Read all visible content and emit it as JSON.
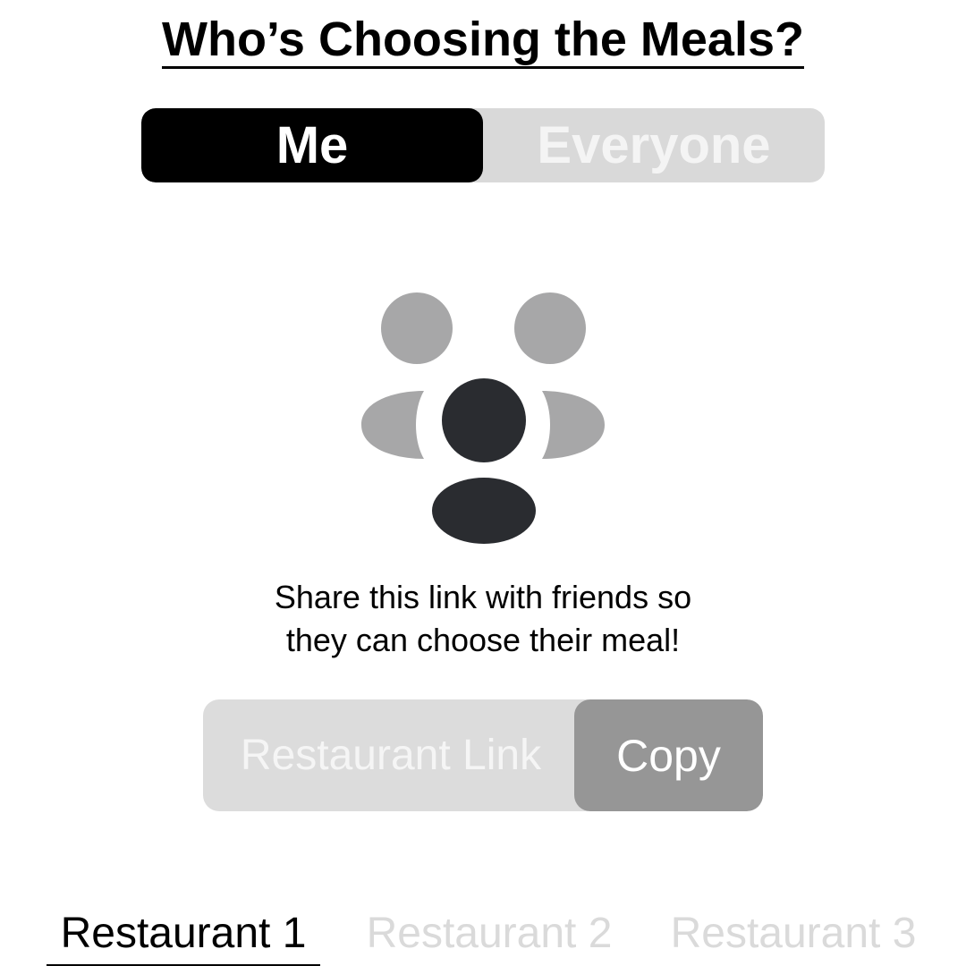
{
  "header": {
    "title": "Who’s Choosing the Meals?"
  },
  "chooser": {
    "options": [
      {
        "label": "Me",
        "selected": true
      },
      {
        "label": "Everyone",
        "selected": false
      }
    ]
  },
  "illustration": {
    "icon": "group-people-icon",
    "colors": {
      "primary": "#2a2c30",
      "secondary": "#a7a7a8"
    }
  },
  "share": {
    "message_line1": "Share this link with friends so",
    "message_line2": "they can choose their meal!",
    "link_placeholder": "Restaurant Link",
    "copy_label": "Copy"
  },
  "restaurants": {
    "tabs": [
      {
        "label": "Restaurant 1",
        "active": true
      },
      {
        "label": "Restaurant 2",
        "active": false
      },
      {
        "label": "Restaurant 3",
        "active": false
      }
    ]
  },
  "colors": {
    "accent": "#000000",
    "inactive_bg": "#d9d9d9",
    "copy_button": "#969696"
  }
}
